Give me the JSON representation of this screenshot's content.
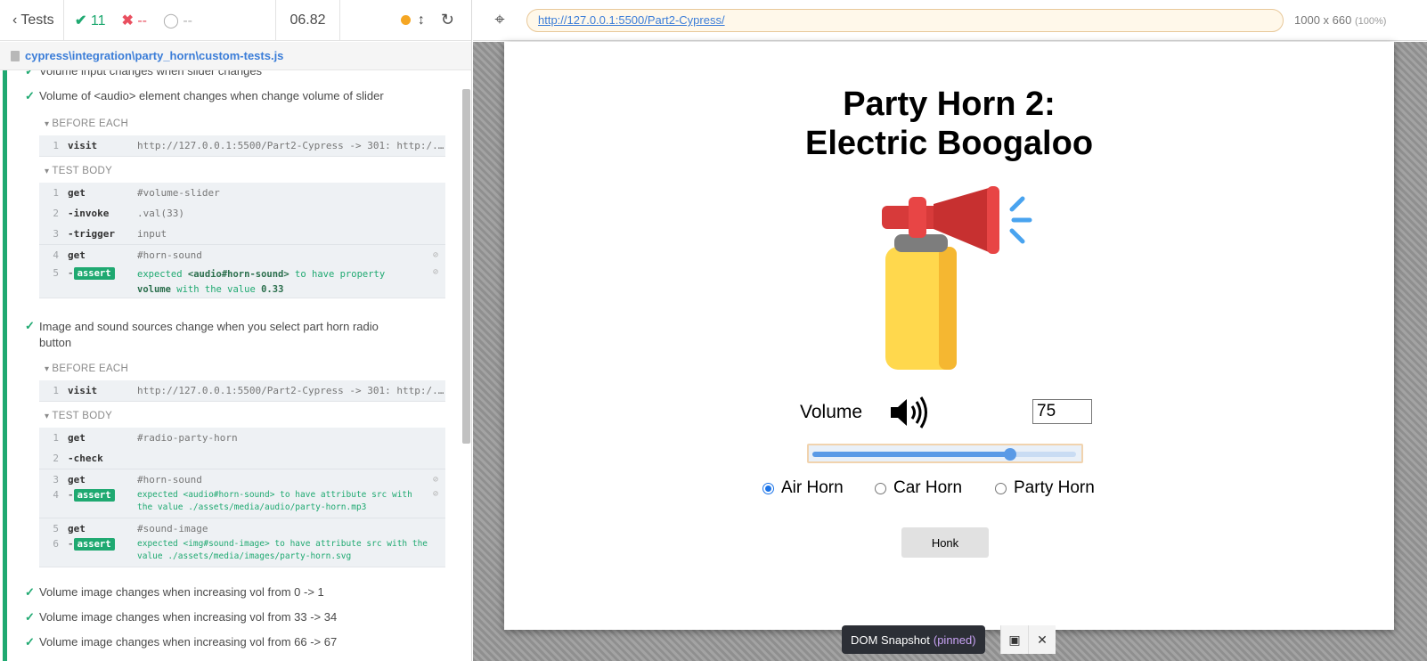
{
  "stats": {
    "back_label": "Tests",
    "passed": "11",
    "failed": "--",
    "pending": "--",
    "duration": "06.82"
  },
  "spec": {
    "path": "cypress\\integration\\party_horn\\custom-tests.js"
  },
  "tests": {
    "prev_cutoff": "Volume input changes when slider changes",
    "t1": {
      "title": "Volume of <audio> element changes when change volume of slider",
      "before_each": "BEFORE EACH",
      "visit": {
        "num": "1",
        "name": "visit",
        "msg": "http://127.0.0.1:5500/Part2-Cypress -> 301: http:/..."
      },
      "body": "TEST BODY",
      "cmds": [
        {
          "num": "1",
          "name": "get",
          "msg": "#volume-slider"
        },
        {
          "num": "2",
          "name": "-invoke",
          "msg": ".val(33)"
        },
        {
          "num": "3",
          "name": "-trigger",
          "msg": "input"
        },
        {
          "num": "4",
          "name": "get",
          "msg": "#horn-sound"
        }
      ],
      "assert": {
        "num": "5",
        "badge": "assert",
        "pre": "expected",
        "subj": "<audio#horn-sound>",
        "mid": "to have property",
        "prop": "volume",
        "with": "with the value",
        "val": "0.33"
      }
    },
    "t2": {
      "title1": "Image and sound sources change when you select part horn radio",
      "title2": "button",
      "before_each": "BEFORE EACH",
      "visit": {
        "num": "1",
        "name": "visit",
        "msg": "http://127.0.0.1:5500/Part2-Cypress -> 301: http:/..."
      },
      "body": "TEST BODY",
      "cmds": [
        {
          "num": "1",
          "name": "get",
          "msg": "#radio-party-horn"
        },
        {
          "num": "2",
          "name": "-check",
          "msg": ""
        },
        {
          "num": "3",
          "name": "get",
          "msg": "#horn-sound"
        },
        {
          "num": "5",
          "name": "get",
          "msg": "#sound-image"
        }
      ],
      "assert4": {
        "num": "4",
        "badge": "assert",
        "line1": "expected <audio#horn-sound> to have attribute src with",
        "line2": "the value ./assets/media/audio/party-horn.mp3"
      },
      "assert6": {
        "num": "6",
        "badge": "assert",
        "line1": "expected <img#sound-image> to have attribute src with the",
        "line2": "value ./assets/media/images/party-horn.svg"
      }
    },
    "t3": "Volume image changes when increasing vol from 0 -> 1",
    "t4": "Volume image changes when increasing vol from 33 -> 34",
    "t5": "Volume image changes when increasing vol from 66 -> 67"
  },
  "aut": {
    "url": "http://127.0.0.1:5500/Part2-Cypress/",
    "viewport": "1000 x 660",
    "zoom": "(100%)"
  },
  "app": {
    "title_line1": "Party Horn 2:",
    "title_line2": "Electric Boogaloo",
    "volume_label": "Volume",
    "volume_value": "75",
    "slider_fraction": 0.75,
    "radios": {
      "air": "Air Horn",
      "car": "Car Horn",
      "party": "Party Horn"
    },
    "selected_radio": "air",
    "honk": "Honk"
  },
  "snapshot": {
    "label": "DOM Snapshot",
    "pinned": "(pinned)"
  },
  "colors": {
    "pass": "#1fa971",
    "fail": "#e94f5f",
    "accent": "#3b7dd8"
  }
}
